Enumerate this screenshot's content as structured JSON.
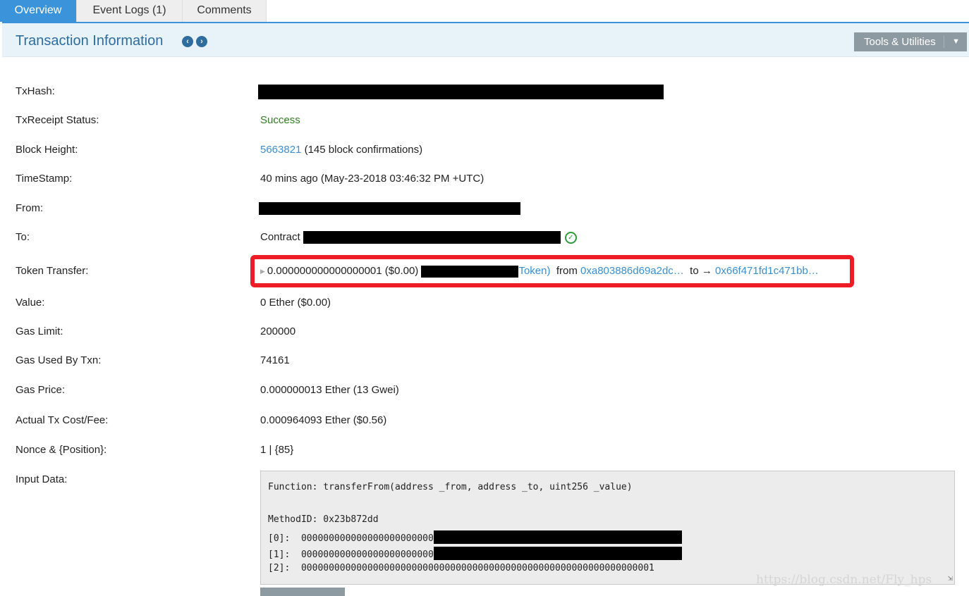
{
  "tabs": [
    {
      "label": "Overview",
      "active": true
    },
    {
      "label": "Event Logs (1)",
      "active": false
    },
    {
      "label": "Comments",
      "active": false
    }
  ],
  "header": {
    "title": "Transaction Information",
    "tools_label": "Tools & Utilities"
  },
  "details": {
    "txhash_label": "TxHash:",
    "status_label": "TxReceipt Status:",
    "status_value": "Success",
    "block_label": "Block Height:",
    "block_number": "5663821",
    "block_confirmations": " (145 block confirmations)",
    "timestamp_label": "TimeStamp:",
    "timestamp_value": "40 mins ago (May-23-2018 03:46:32 PM +UTC)",
    "from_label": "From:",
    "to_label": "To:",
    "to_prefix": "Contract ",
    "token_label": "Token Transfer:",
    "token_amount": "0.000000000000000001 ($0.00) ",
    "token_name": "Token)",
    "token_from_word": "from",
    "token_from_addr": "0xa803886d69a2dc…",
    "token_to_word": "to →",
    "token_to_addr": "0x66f471fd1c471bb…",
    "value_label": "Value:",
    "value_value": "0 Ether ($0.00)",
    "gas_limit_label": "Gas Limit:",
    "gas_limit_value": "200000",
    "gas_used_label": "Gas Used By Txn:",
    "gas_used_value": "74161",
    "gas_price_label": "Gas Price:",
    "gas_price_value": "0.000000013 Ether (13 Gwei)",
    "cost_label": "Actual Tx Cost/Fee:",
    "cost_value": "0.000964093 Ether ($0.56)",
    "nonce_label": "Nonce & {Position}:",
    "nonce_value": "1 | {85}",
    "input_label": "Input Data:"
  },
  "input_data": {
    "function_line": "Function: transferFrom(address _from, address _to, uint256 _value)",
    "method_line": "MethodID: 0x23b872dd",
    "param0": "[0]:  000000000000000000000000",
    "param1": "[1]:  000000000000000000000000",
    "param2": "[2]:  0000000000000000000000000000000000000000000000000000000000000001"
  },
  "watermark": "https://blog.csdn.net/Fly_hps",
  "colors": {
    "accent": "#3b94d9",
    "success": "#2f7d20",
    "link": "#3b8fd0",
    "highlight": "#ee1c25"
  }
}
